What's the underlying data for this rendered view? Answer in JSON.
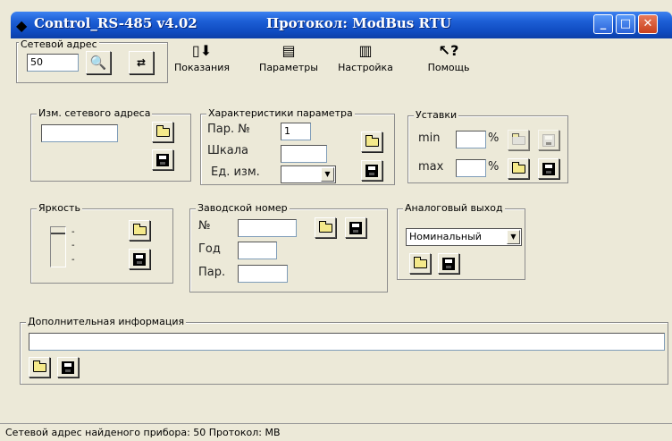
{
  "titlebar": {
    "app_title": "Control_RS-485 v4.02",
    "protocol_title": "Протокол: ModBus RTU",
    "minimize": "_",
    "maximize": "□",
    "close": "✕"
  },
  "toolbar": {
    "address_legend": "Сетевой адрес",
    "address_value": "50",
    "readings_label": "Показания",
    "params_label": "Параметры",
    "settings_label": "Настройка",
    "help_label": "Помощь"
  },
  "address_change": {
    "legend": "Изм. сетевого адреса",
    "value": ""
  },
  "param_chars": {
    "legend": "Характеристики параметра",
    "par_label": "Пар. №",
    "par_value": "1",
    "scale_label": "Шкала",
    "scale_value": "",
    "unit_label": "Ед. изм.",
    "unit_value": ""
  },
  "setpoints": {
    "legend": "Уставки",
    "min_label": "min",
    "max_label": "max",
    "percent": "%",
    "min_value": "",
    "max_value": ""
  },
  "brightness": {
    "legend": "Яркость",
    "level": 1
  },
  "serial": {
    "legend": "Заводской номер",
    "no_label": "№",
    "year_label": "Год",
    "par_label": "Пар.",
    "no_value": "",
    "year_value": "",
    "par_value": ""
  },
  "analog": {
    "legend": "Аналоговый выход",
    "selected": "Номинальный"
  },
  "extra_info": {
    "legend": "Дополнительная информация",
    "value": ""
  },
  "status": {
    "text": "Сетевой адрес найденого прибора: 50    Протокол: MB"
  },
  "colors": {
    "titlebar": "#1d5fd6",
    "window_bg": "#ece9d8",
    "close": "#c8401c"
  }
}
